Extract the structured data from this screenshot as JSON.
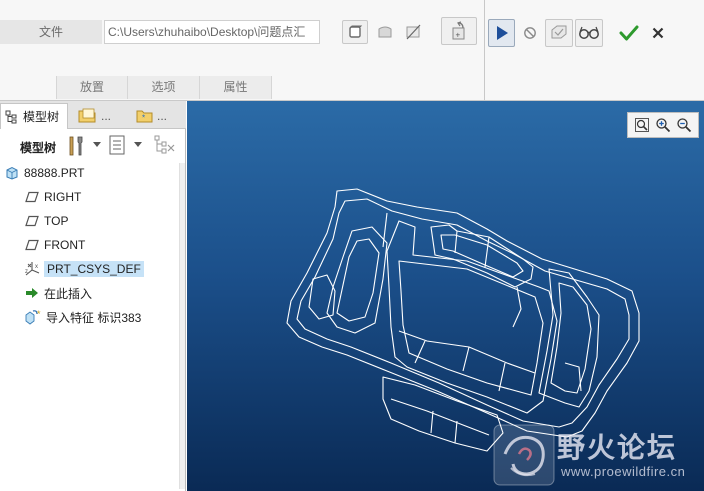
{
  "ribbon": {
    "file_label": "文件",
    "path_value": "C:\\Users\\zhuhaibo\\Desktop\\问题点汇",
    "tabs": [
      "放置",
      "选项",
      "属性"
    ]
  },
  "panel": {
    "tabs": [
      {
        "label": "模型树",
        "icon": "tree-icon"
      },
      {
        "label": "...",
        "icon": "folder-icon"
      },
      {
        "label": "...",
        "icon": "favorites-icon"
      }
    ],
    "toolbar_label": "模型树"
  },
  "tree": {
    "items": [
      {
        "label": "88888.PRT",
        "icon": "part-icon",
        "selected": false
      },
      {
        "label": "RIGHT",
        "icon": "datum-plane-icon",
        "selected": false
      },
      {
        "label": "TOP",
        "icon": "datum-plane-icon",
        "selected": false
      },
      {
        "label": "FRONT",
        "icon": "datum-plane-icon",
        "selected": false
      },
      {
        "label": "PRT_CSYS_DEF",
        "icon": "csys-icon",
        "selected": true
      },
      {
        "label": "在此插入",
        "icon": "insert-arrow-icon",
        "selected": false
      },
      {
        "label": "导入特征 标识383",
        "icon": "import-feature-icon",
        "selected": false
      }
    ]
  },
  "watermark": {
    "title": "野火论坛",
    "url": "www.proewildfire.cn"
  },
  "colors": {
    "viewport_top": "#2b6ba7",
    "viewport_bottom": "#0a2a55",
    "selection": "#c6e2f7",
    "ok_green": "#2e9a2e",
    "play_blue": "#1e4f9a"
  }
}
